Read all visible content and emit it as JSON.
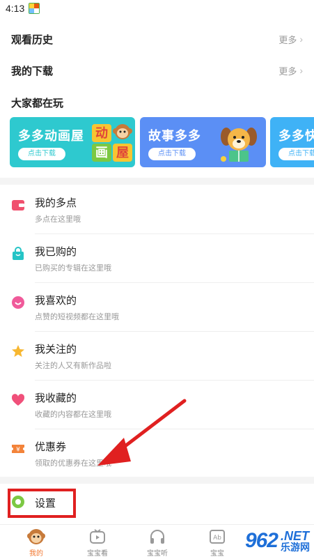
{
  "status_bar": {
    "time": "4:13"
  },
  "sections": {
    "history": {
      "title": "观看历史",
      "more": "更多"
    },
    "downloads": {
      "title": "我的下载",
      "more": "更多"
    },
    "everyone_plays": {
      "title": "大家都在玩"
    }
  },
  "banners": [
    {
      "title": "多多动画屋",
      "button": "点击下载",
      "color": "#2ec9cf",
      "art_chars": [
        "动",
        "画",
        "屋"
      ]
    },
    {
      "title": "故事多多",
      "button": "点击下载",
      "color": "#5b8ff5"
    },
    {
      "title": "多多快",
      "button": "点击下载",
      "color": "#3fb2f6"
    }
  ],
  "menu": [
    {
      "title": "我的多点",
      "sub": "多点在这里哦",
      "icon": "wallet-icon",
      "color": "#f0506e"
    },
    {
      "title": "我已购的",
      "sub": "已购买的专辑在这里哦",
      "icon": "shopping-bag-icon",
      "color": "#25c4c6"
    },
    {
      "title": "我喜欢的",
      "sub": "点赞的短视频都在这里哦",
      "icon": "smile-icon",
      "color": "#f05a9a"
    },
    {
      "title": "我关注的",
      "sub": "关注的人又有新作品啦",
      "icon": "star-icon",
      "color": "#f7b731"
    },
    {
      "title": "我收藏的",
      "sub": "收藏的内容都在这里哦",
      "icon": "heart-icon",
      "color": "#f0507a"
    },
    {
      "title": "优惠券",
      "sub": "领取的优惠券在这里哦",
      "icon": "coupon-icon",
      "color": "#f3833a"
    }
  ],
  "settings": {
    "label": "设置",
    "icon": "gear-icon",
    "color": "#7cc843"
  },
  "tabs": [
    {
      "label": "我的",
      "icon": "monkey-icon",
      "active": true
    },
    {
      "label": "宝宝看",
      "icon": "tv-icon",
      "active": false
    },
    {
      "label": "宝宝听",
      "icon": "headphones-icon",
      "active": false
    },
    {
      "label": "宝宝",
      "icon": "abc-icon",
      "active": false
    }
  ],
  "watermark": {
    "main": "962",
    "net": ".NET",
    "cn": "乐游网"
  },
  "colors": {
    "accent": "#f2762e",
    "annotation_red": "#e02020"
  }
}
